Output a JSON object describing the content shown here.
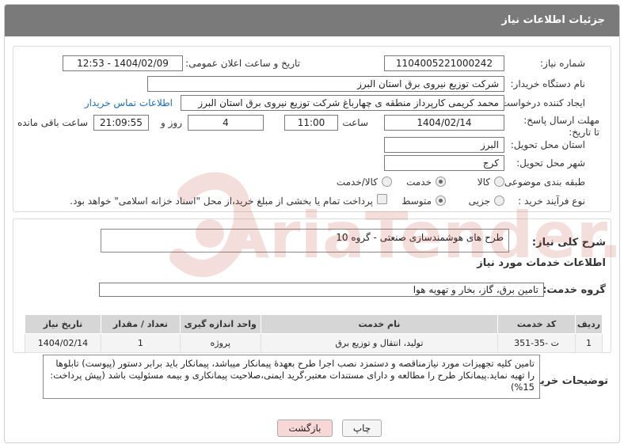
{
  "header": {
    "title": "جزئیات اطلاعات نیاز"
  },
  "fields": {
    "need_number_label": "شماره نیاز:",
    "need_number": "1104005221000242",
    "announce_label": "تاریخ و ساعت اعلان عمومی:",
    "announce_value": "1404/02/09 - 12:53",
    "buyer_org_label": "نام دستگاه خریدار:",
    "buyer_org": "شرکت توزیع نیروی برق استان البرز",
    "requester_label": "ایجاد کننده درخواست:",
    "requester": "محمد کریمی کارپرداز منطقه ی چهارباغ شرکت توزیع نیروی برق استان البرز",
    "buyer_contact_link": "اطلاعات تماس خریدار",
    "deadline_label": "مهلت ارسال پاسخ: تا تاریخ:",
    "deadline_date": "1404/02/14",
    "time_label": "ساعت",
    "deadline_time": "11:00",
    "days_value": "4",
    "days_label": "روز و",
    "remaining_time": "21:09:55",
    "remaining_label": "ساعت باقی مانده",
    "province_label": "استان محل تحویل:",
    "province": "البرز",
    "city_label": "شهر محل تحویل:",
    "city": "کرج",
    "category_label": "طبقه بندی موضوعی:",
    "category_options": [
      "کالا",
      "خدمت",
      "کالا/خدمت"
    ],
    "category_selected": 1,
    "process_label": "نوع فرآیند خرید :",
    "process_options": [
      "جزیی",
      "متوسط"
    ],
    "process_selected": 1,
    "payment_note": "پرداخت تمام یا بخشی از مبلغ خرید،از محل \"اسناد خزانه اسلامی\" خواهد بود."
  },
  "summary": {
    "label": "شرح کلی نیاز:",
    "value": "طرح های هوشمندسازی صنعتی - گروه 10"
  },
  "services": {
    "section_title": "اطلاعات خدمات مورد نیاز",
    "group_label": "گروه خدمت:",
    "group_value": "تامین برق، گاز، بخار و تهویه هوا",
    "table": {
      "headers": [
        "ردیف",
        "کد خدمت",
        "نام خدمت",
        "واحد اندازه گیری",
        "تعداد / مقدار",
        "تاریخ نیاز"
      ],
      "rows": [
        [
          "1",
          "ت -35-351",
          "تولید، انتقال و توزیع برق",
          "پروژه",
          "1",
          "1404/02/14"
        ]
      ]
    }
  },
  "buyer_notes": {
    "label": "توضیحات خریدار:",
    "value": "تامین کلیه تجهیزات مورد نیازمناقصه و دستمزد نصب اجرا طرح بعهدۀ پیمانکار میباشد، پیمانکار باید برابر دستور (پیوست) تابلوها را تهیه نماید.پیمانکار طرح را مطالعه و دارای مستندات معتبر،گرید ایمنی،صلاحیت پیمانکاری و بیمه مسئولیت باشد (پیش پرداخت: 15%)"
  },
  "buttons": {
    "print": "چاپ",
    "back": "بازگشت"
  },
  "colors": {
    "header_bg": "#7a7a7a",
    "link": "#1d6fb8",
    "back_bg": "#f8d7d7",
    "watermark": "#c0392b"
  }
}
